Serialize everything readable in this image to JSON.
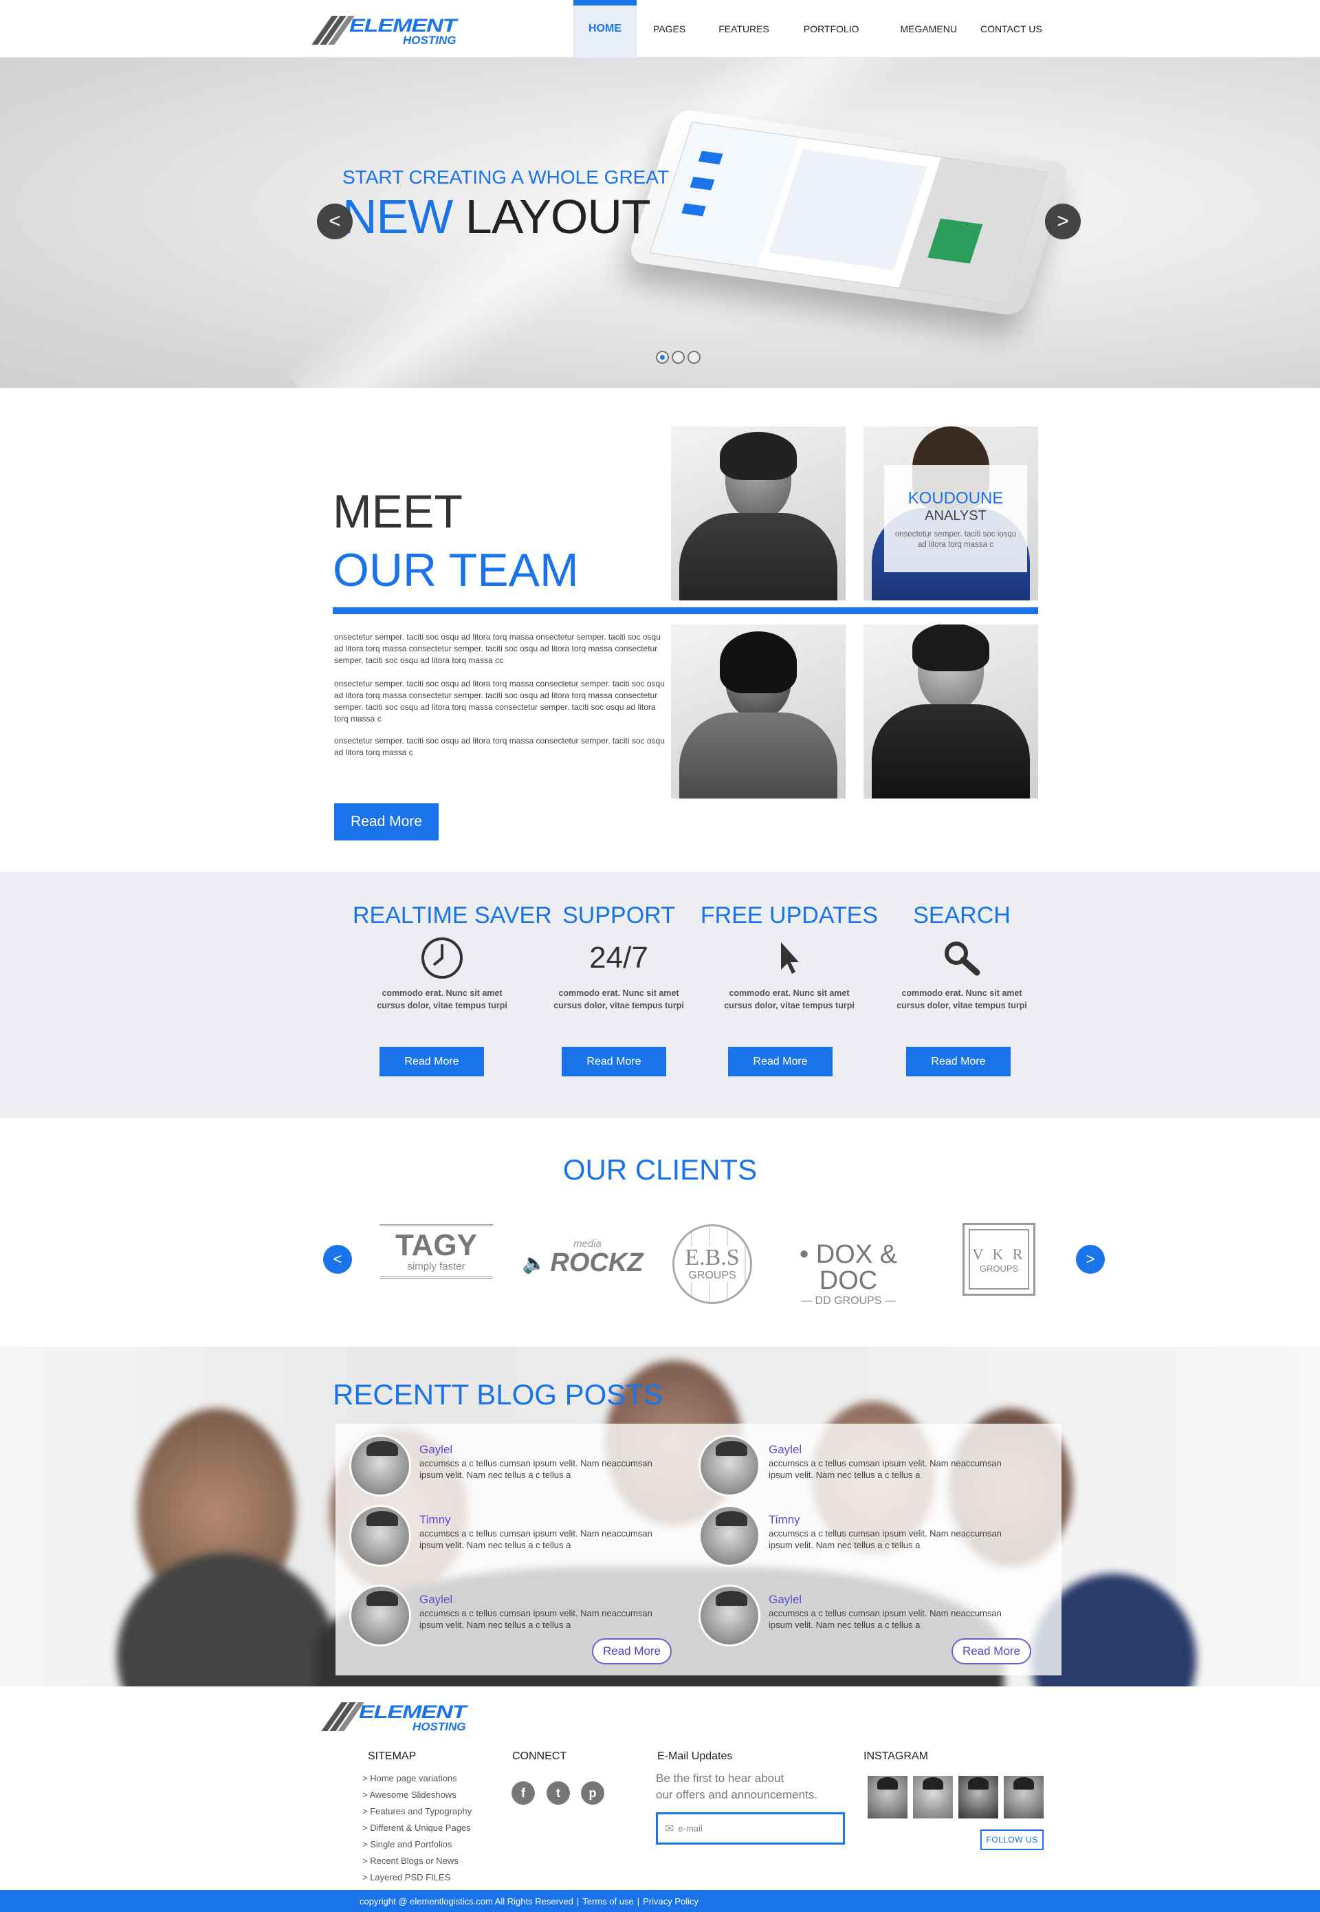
{
  "brand": {
    "word1": "ELEMENT",
    "word2": "HOSTING"
  },
  "nav": {
    "items": [
      "HOME",
      "PAGES",
      "FEATURES",
      "PORTFOLIO",
      "MEGAMENU",
      "CONTACT US"
    ],
    "active": "HOME"
  },
  "hero": {
    "subtitle": "START CREATING A WHOLE GREAT",
    "title_a": "NEW",
    "title_b": "LAYOUT",
    "prev": "<",
    "next": ">",
    "slide_count": 3,
    "active_slide": 1
  },
  "team": {
    "heading1": "MEET",
    "heading2": "OUR TEAM",
    "paragraphs": [
      "onsectetur semper. taciti soc osqu ad litora torq massa onsectetur semper. taciti soc osqu ad litora torq massa consectetur semper. taciti soc osqu ad litora torq massa consectetur semper. taciti soc osqu ad litora torq massa cc",
      "onsectetur semper. taciti soc osqu ad litora torq massa consectetur semper. taciti soc osqu ad litora torq massa consectetur semper. taciti soc osqu ad litora torq massa consectetur semper. taciti soc osqu ad litora torq massa consectetur semper. taciti soc osqu ad litora torq massa c",
      "onsectetur semper. taciti soc osqu ad litora torq massa consectetur semper. taciti soc osqu ad litora torq massa c"
    ],
    "read_more": "Read More",
    "overlay": {
      "name": "KOUDOUNE",
      "role": "ANALYST",
      "text": "onsectetur semper. taciti soc iosqu ad litora torq massa c"
    }
  },
  "features": [
    {
      "title": "REALTIME SAVER",
      "icon": "clock-icon",
      "text1": "commodo erat. Nunc sit amet",
      "text2": "cursus dolor, vitae tempus turpi",
      "button": "Read More"
    },
    {
      "title": "SUPPORT",
      "icon": "24/7",
      "text1": "commodo erat. Nunc sit amet",
      "text2": "cursus dolor, vitae tempus turpi",
      "button": "Read More"
    },
    {
      "title": "FREE UPDATES",
      "icon": "cursor-icon",
      "text1": "commodo erat. Nunc sit amet",
      "text2": "cursus dolor, vitae tempus turpi",
      "button": "Read More"
    },
    {
      "title": "SEARCH",
      "icon": "search-icon",
      "text1": "commodo erat. Nunc sit amet",
      "text2": "cursus dolor, vitae tempus turpi",
      "button": "Read More"
    }
  ],
  "clients": {
    "title": "OUR CLIENTS",
    "prev": "<",
    "next": ">",
    "logos": [
      {
        "name": "TAGY",
        "tag": "simply faster"
      },
      {
        "name": "ROCKZ",
        "tag": "media"
      },
      {
        "name": "E.B.S",
        "tag": "GROUPS"
      },
      {
        "name": "DOX & DOC",
        "tag": "DD GROUPS"
      },
      {
        "name": "V K R",
        "tag": "GROUPS"
      }
    ]
  },
  "blog": {
    "title": "RECENTT BLOG POSTS",
    "posts": [
      {
        "name": "Gaylel",
        "text": "accumscs a c tellus cumsan ipsum velit. Nam neaccumsan ipsum velit. Nam nec tellus a c tellus a"
      },
      {
        "name": "Timny",
        "text": "accumscs a c tellus cumsan ipsum velit. Nam neaccumsan ipsum velit. Nam nec tellus a c tellus a"
      },
      {
        "name": "Gaylel",
        "text": "accumscs a c tellus cumsan ipsum velit. Nam neaccumsan ipsum velit. Nam nec tellus a c tellus a"
      },
      {
        "name": "Gaylel",
        "text": "accumscs a c tellus cumsan ipsum velit. Nam neaccumsan ipsum velit. Nam nec tellus a c tellus a"
      },
      {
        "name": "Timny",
        "text": "accumscs a c tellus cumsan ipsum velit. Nam neaccumsan ipsum velit. Nam nec tellus a c tellus a"
      },
      {
        "name": "Gaylel",
        "text": "accumscs a c tellus cumsan ipsum velit. Nam neaccumsan ipsum velit. Nam nec tellus a c tellus a"
      }
    ],
    "read_more": "Read More"
  },
  "footer": {
    "sitemap_title": "SITEMAP",
    "sitemap": [
      "> Home page variations",
      "> Awesome Slideshows",
      "> Features and Typography",
      "> Different & Unique Pages",
      "> Single and Portfolios",
      "> Recent Blogs or News",
      "> Layered PSD FILES"
    ],
    "connect_title": "CONNECT",
    "social": [
      "f",
      "t",
      "p"
    ],
    "email_title": "E-Mail Updates",
    "email_text1": "Be the first to hear about",
    "email_text2": "our offers and announcements.",
    "email_placeholder": "e-mail",
    "instagram_title": "INSTAGRAM",
    "follow": "FOLLOW US",
    "copyright": "copyright @ elementlogistics.com All Rights Reserved",
    "terms": "Terms of use",
    "privacy": "Privacy Policy"
  },
  "colors": {
    "accent": "#1a73e8",
    "purple": "#5a4fcf",
    "gray_bg": "#eceef2"
  }
}
